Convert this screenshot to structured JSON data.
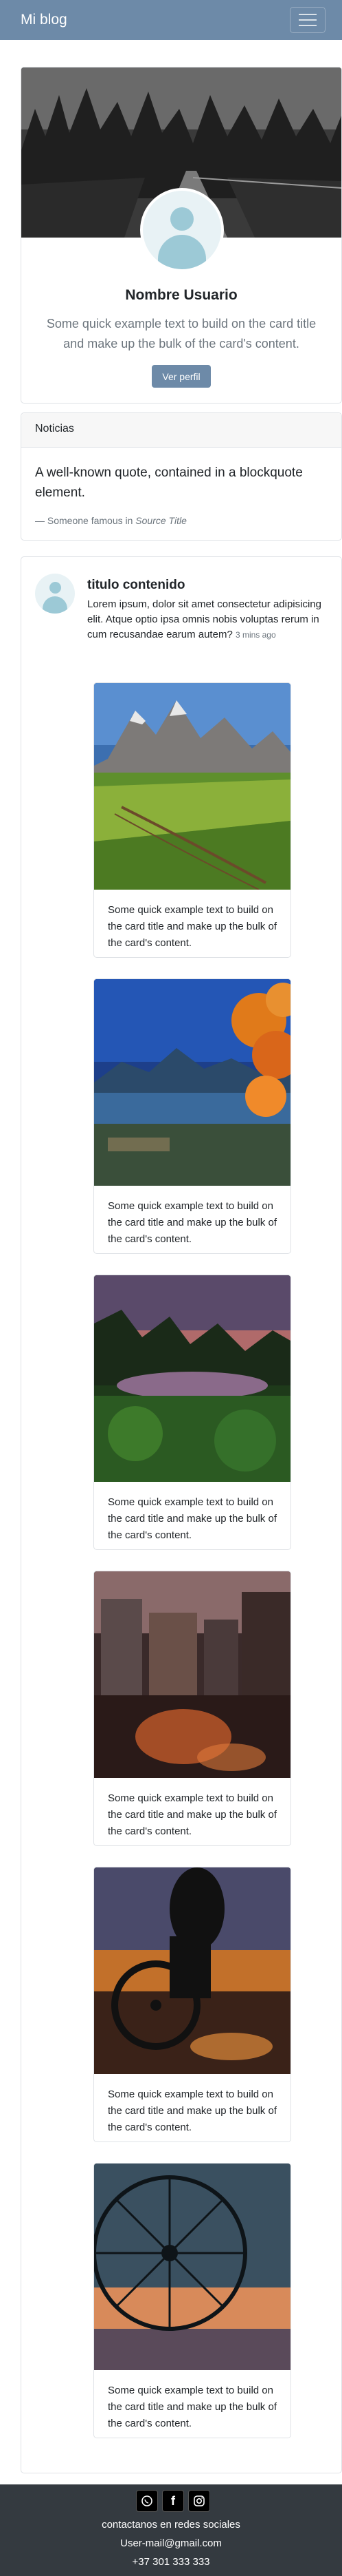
{
  "navbar": {
    "brand": "Mi blog",
    "toggler_icon": "hamburger-icon"
  },
  "profile": {
    "name": "Nombre Usuario",
    "text": "Some quick example text to build on the card title and make up the bulk of the card's content.",
    "button_label": "Ver perfil"
  },
  "news": {
    "header": "Noticias",
    "quote": "A well-known quote, contained in a blockquote element.",
    "footer_prefix": "— Someone famous in ",
    "footer_source": "Source Title"
  },
  "feed": {
    "title": "titulo contenido",
    "text": "Lorem ipsum, dolor sit amet consectetur adipisicing elit. Atque optio ipsa omnis nobis voluptas rerum in cum recusandae earum autem?",
    "time": "3 mins ago",
    "cards": [
      {
        "text": "Some quick example text to build on the card title and make up the bulk of the card's content."
      },
      {
        "text": "Some quick example text to build on the card title and make up the bulk of the card's content."
      },
      {
        "text": "Some quick example text to build on the card title and make up the bulk of the card's content."
      },
      {
        "text": "Some quick example text to build on the card title and make up the bulk of the card's content."
      },
      {
        "text": "Some quick example text to build on the card title and make up the bulk of the card's content."
      },
      {
        "text": "Some quick example text to build on the card title and make up the bulk of the card's content."
      }
    ]
  },
  "footer": {
    "social_icons": [
      "whatsapp-icon",
      "facebook-icon",
      "instagram-icon"
    ],
    "contact_label": "contactanos en redes sociales",
    "email": "User-mail@gmail.com",
    "phone": "+37 301 333 333"
  }
}
